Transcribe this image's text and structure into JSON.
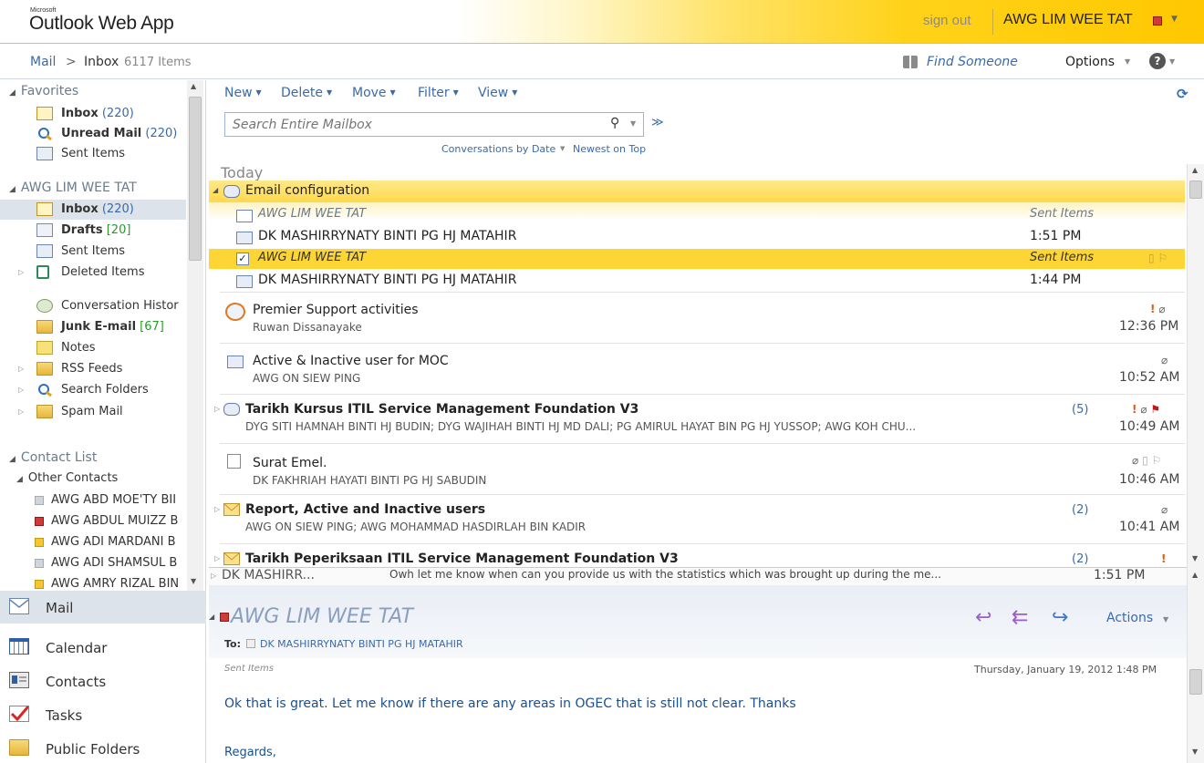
{
  "header": {
    "brand_small": "Microsoft",
    "brand": "Outlook Web App",
    "sign_out": "sign out",
    "user": "AWG LIM WEE TAT"
  },
  "breadcrumb": {
    "mail": "Mail",
    "separator": ">",
    "folder": "Inbox",
    "count": "6117 Items",
    "find_someone": "Find Someone",
    "options": "Options",
    "help": "?"
  },
  "nav": {
    "favorites_head": "Favorites",
    "favorites": [
      {
        "label": "Inbox",
        "count": "(220)"
      },
      {
        "label": "Unread Mail",
        "count": "(220)"
      },
      {
        "label": "Sent Items",
        "count": ""
      }
    ],
    "mailbox_head": "AWG LIM WEE TAT",
    "mailbox": [
      {
        "label": "Inbox",
        "count": "(220)"
      },
      {
        "label": "Drafts",
        "count": "[20]"
      },
      {
        "label": "Sent Items",
        "count": ""
      },
      {
        "label": "Deleted Items",
        "count": ""
      },
      {
        "label": "Conversation Histor",
        "count": ""
      },
      {
        "label": "Junk E-mail",
        "count": "[67]"
      },
      {
        "label": "Notes",
        "count": ""
      },
      {
        "label": "RSS Feeds",
        "count": ""
      },
      {
        "label": "Search Folders",
        "count": ""
      },
      {
        "label": "Spam Mail",
        "count": ""
      }
    ],
    "contacts_head": "Contact List",
    "other_contacts": "Other Contacts",
    "contacts": [
      {
        "label": "AWG ABD MOE'TY BII",
        "status": "#cfd5dc"
      },
      {
        "label": "AWG ABDUL MUIZZ B",
        "status": "#d23a3a"
      },
      {
        "label": "AWG ADI MARDANI B",
        "status": "#f3c632"
      },
      {
        "label": "AWG ADI SHAMSUL B",
        "status": "#cfd5dc"
      },
      {
        "label": "AWG AMRY RIZAL BIN",
        "status": "#f3c632"
      }
    ]
  },
  "modules": [
    {
      "label": "Mail"
    },
    {
      "label": "Calendar"
    },
    {
      "label": "Contacts"
    },
    {
      "label": "Tasks"
    },
    {
      "label": "Public Folders"
    }
  ],
  "toolbar": {
    "new": "New",
    "delete": "Delete",
    "move": "Move",
    "filter": "Filter",
    "view": "View",
    "search_placeholder": "Search Entire Mailbox",
    "sort": "Conversations by Date",
    "order": "Newest on Top"
  },
  "messages": {
    "group": "Today",
    "conv1": {
      "subject": "Email configuration",
      "items": [
        {
          "name": "AWG LIM WEE TAT",
          "right": "Sent Items"
        },
        {
          "name": "DK MASHIRRYNATY BINTI PG HJ MATAHIR",
          "right": "1:51 PM"
        },
        {
          "name": "AWG LIM WEE TAT",
          "right": "Sent Items"
        },
        {
          "name": "DK MASHIRRYNATY BINTI PG HJ MATAHIR",
          "right": "1:44 PM"
        }
      ]
    },
    "list": [
      {
        "subject": "Premier Support activities",
        "from": "Ruwan Dissanayake",
        "time": "12:36 PM",
        "count": ""
      },
      {
        "subject": "Active & Inactive user for MOC",
        "from": "AWG ON SIEW PING",
        "time": "10:52 AM",
        "count": ""
      },
      {
        "subject": "Tarikh Kursus ITIL Service Management Foundation V3",
        "from": "DYG SITI HAMNAH BINTI HJ BUDIN; DYG WAJIHAH BINTI HJ MD DALI; PG AMIRUL HAYAT BIN PG HJ YUSSOP; AWG KOH CHU...",
        "time": "10:49 AM",
        "count": "(5)"
      },
      {
        "subject": "Surat Emel.",
        "from": "DK FAKHRIAH HAYATI BINTI PG HJ SABUDIN",
        "time": "10:46 AM",
        "count": ""
      },
      {
        "subject": "Report, Active and Inactive users",
        "from": "AWG ON SIEW PING; AWG MOHAMMAD HASDIRLAH BIN KADIR",
        "time": "10:41 AM",
        "count": "(2)"
      },
      {
        "subject": "Tarikh Peperiksaan ITIL Service Management Foundation V3",
        "from": "",
        "time": "",
        "count": "(2)"
      }
    ]
  },
  "reading": {
    "preview_from": "DK MASHIRR...",
    "preview_snippet": "Owh let me know when can you provide us with the statistics which was brought up during the me...",
    "preview_time": "1:51 PM",
    "sender": "AWG LIM WEE TAT",
    "to_label": "To:",
    "to": "DK MASHIRRYNATY BINTI PG HJ MATAHIR",
    "folder": "Sent Items",
    "date": "Thursday, January 19, 2012 1:48 PM",
    "actions": "Actions",
    "body": "Ok that is great. Let me know if there are any areas in OGEC that is still not clear. Thanks",
    "regards": "Regards,"
  }
}
